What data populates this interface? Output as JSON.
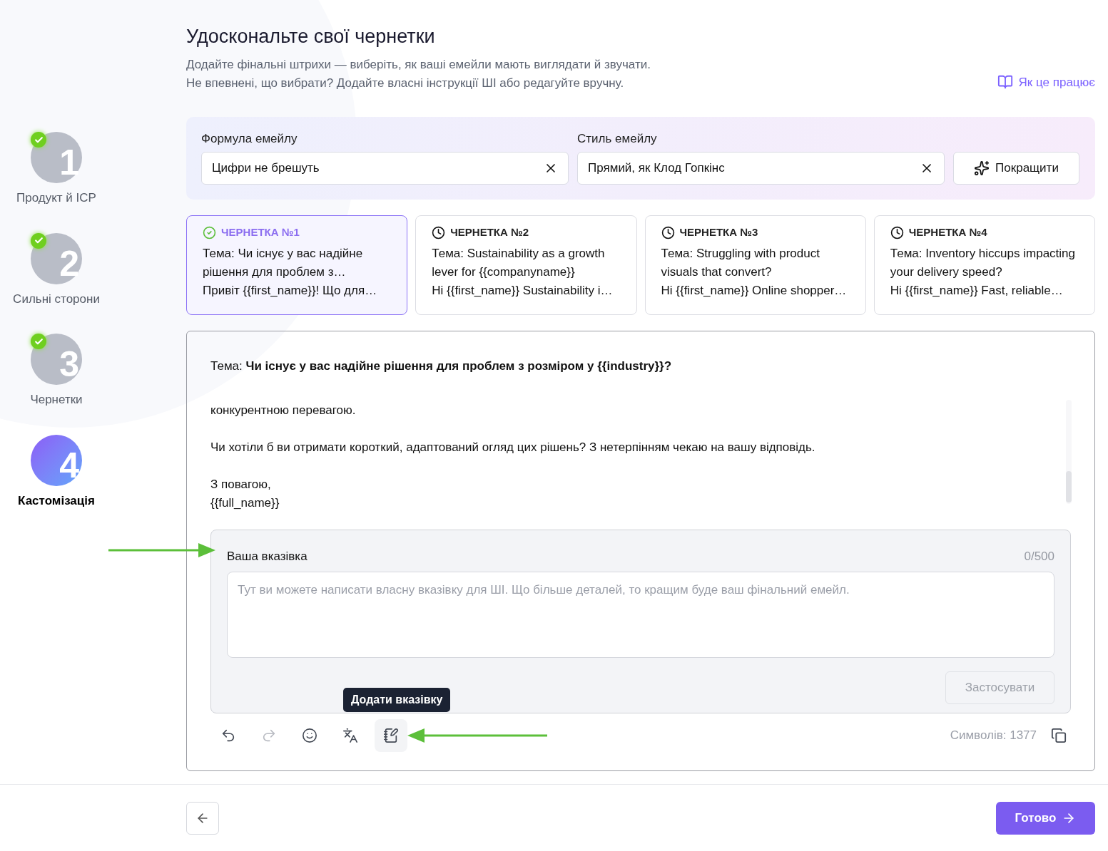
{
  "steps": [
    {
      "number": "1",
      "label": "Продукт й ICP",
      "done": true,
      "selected": false
    },
    {
      "number": "2",
      "label": "Сильні сторони",
      "done": true,
      "selected": false
    },
    {
      "number": "3",
      "label": "Чернетки",
      "done": true,
      "selected": false
    },
    {
      "number": "4",
      "label": "Кастомізація",
      "done": false,
      "selected": true
    }
  ],
  "header": {
    "title": "Удоскональте свої чернетки",
    "subtitle_lines": [
      "Додайте фінальні штрихи — виберіть, як ваші емейли мають виглядати й звучати.",
      "Не впевнені, що вибрати? Додайте власні інструкції ШІ або редагуйте вручну."
    ],
    "help_link": "Як це працює"
  },
  "settings": {
    "fields": [
      {
        "label": "Формула емейлу",
        "value": "Цифри не брешуть"
      },
      {
        "label": "Стиль емейлу",
        "value": "Прямий, як Клод Гопкінс"
      }
    ],
    "improve_button": "Покращити"
  },
  "drafts": [
    {
      "title": "ЧЕРНЕТКА №1",
      "selected": true,
      "subject": "Тема: Чи існує у вас надійне рішення для проблем з…",
      "preview": "Привіт {{first_name}}! Що для…"
    },
    {
      "title": "ЧЕРНЕТКА №2",
      "selected": false,
      "subject": "Тема: Sustainability as a growth lever for {{companyname}}",
      "preview": "Hi {{first_name}} Sustainability i…"
    },
    {
      "title": "ЧЕРНЕТКА №3",
      "selected": false,
      "subject": "Тема: Struggling with product visuals that convert?",
      "preview": "Hi {{first_name}} Online shopper…"
    },
    {
      "title": "ЧЕРНЕТКА №4",
      "selected": false,
      "subject": "Тема: Inventory hiccups impacting your delivery speed?",
      "preview": "Hi {{first_name}} Fast, reliable…"
    }
  ],
  "editor": {
    "subject_label": "Тема:",
    "subject": "Чи існує у вас надійне рішення для проблем з розміром у {{industry}}?",
    "paragraphs": [
      [
        "конкурентною перевагою."
      ],
      [
        "Чи хотіли б ви отримати короткий, адаптований огляд цих рішень? З нетерпінням чекаю на вашу відповідь."
      ],
      [
        "З повагою,",
        "{{full_name}}"
      ]
    ],
    "instruction": {
      "label": "Ваша вказівка",
      "counter": "0/500",
      "placeholder": "Тут ви можете написати власну вказівку для ШІ. Що більше деталей, то кращим буде ваш фінальний емейл.",
      "apply_button": "Застосувати",
      "apply_disabled": true
    },
    "tooltip": "Додати вказівку",
    "tools": [
      {
        "kind": "undo",
        "disabled": false,
        "selected": false
      },
      {
        "kind": "redo",
        "disabled": true,
        "selected": false
      },
      {
        "kind": "emoji",
        "disabled": false,
        "selected": false
      },
      {
        "kind": "translate",
        "disabled": false,
        "selected": false
      },
      {
        "kind": "note",
        "disabled": false,
        "selected": true
      }
    ],
    "char_count": "Символів: 1377"
  },
  "footer": {
    "done_button": "Готово"
  }
}
